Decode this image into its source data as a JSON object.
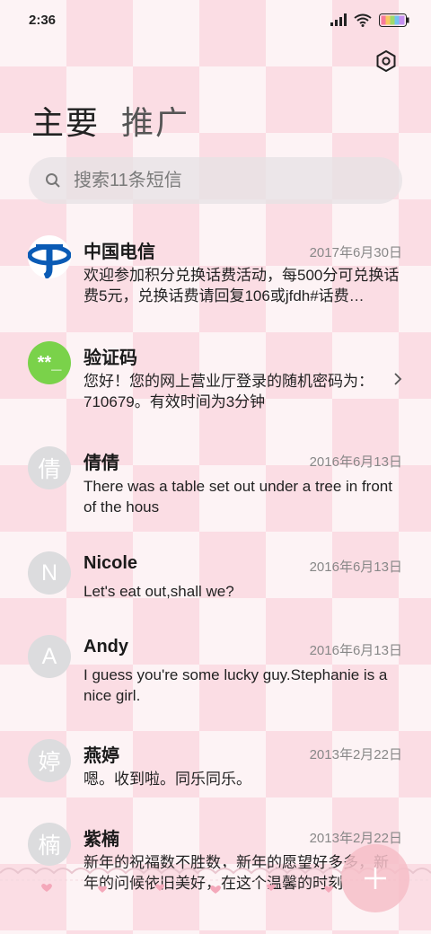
{
  "status": {
    "time": "2:36"
  },
  "tabs": {
    "primary": "主要",
    "promo": "推广"
  },
  "search": {
    "placeholder": "搜索11条短信"
  },
  "messages": [
    {
      "sender": "中国电信",
      "date": "2017年6月30日",
      "preview": "欢迎参加积分兑换话费活动，每500分可兑换话费5元，兑换话费请回复106或jfdh#话费…",
      "avatar_icon": "china-telecom-logo"
    },
    {
      "sender": "验证码",
      "date": "",
      "preview": "您好！您的网上营业厅登录的随机密码为：710679。有效时间为3分钟",
      "avatar_text": "**_"
    },
    {
      "sender": "倩倩",
      "date": "2016年6月13日",
      "preview": "There was a table set out under a tree in front of the hous",
      "avatar_text": "倩"
    },
    {
      "sender": "Nicole",
      "date": "2016年6月13日",
      "preview": "Let's eat out,shall we?",
      "avatar_text": "N"
    },
    {
      "sender": "Andy",
      "date": "2016年6月13日",
      "preview": "I guess you're some lucky guy.Stephanie is a nice girl.",
      "avatar_text": "A"
    },
    {
      "sender": "燕婷",
      "date": "2013年2月22日",
      "preview": "嗯。收到啦。同乐同乐。",
      "avatar_text": "婷"
    },
    {
      "sender": "紫楠",
      "date": "2013年2月22日",
      "preview": "新年的祝福数不胜数，新年的愿望好多多，新年的问候依旧美好，在这个温馨的时刻",
      "avatar_text": "楠"
    }
  ],
  "colors": {
    "accent_pink": "#f6bec8",
    "verify_green": "#7ad24a",
    "telecom_blue": "#0a5bb5"
  }
}
